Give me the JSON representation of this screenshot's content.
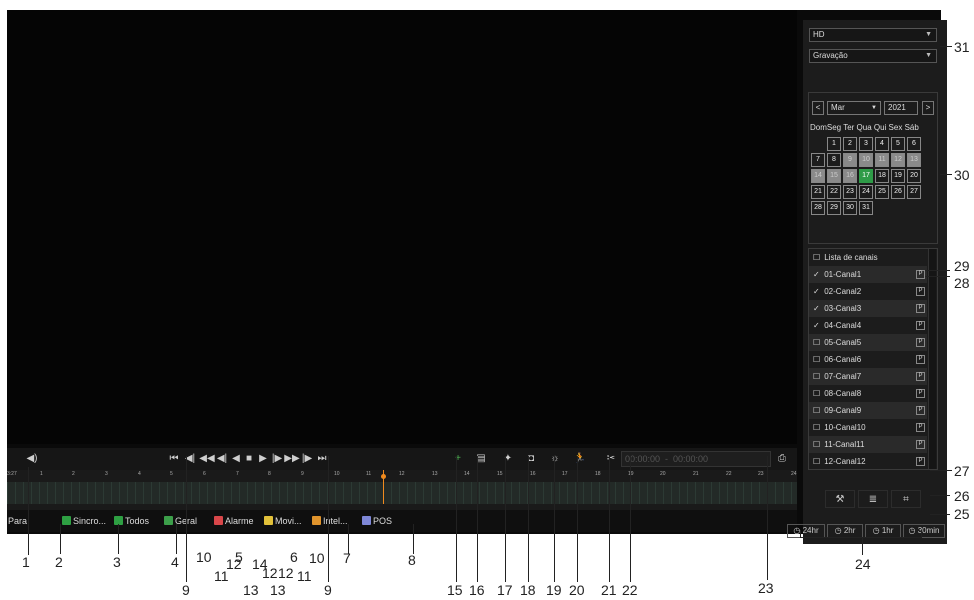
{
  "controls": {
    "status": "Para",
    "time_range": "00:00:00  -  00:00:00",
    "icons": [
      "speaker-icon",
      "skip-start-icon",
      "prev-frame-icon",
      "rewind-icon",
      "slow-backward-icon",
      "play-backward-icon",
      "stop-icon",
      "play-icon",
      "slow-forward-icon",
      "fast-forward-icon",
      "next-frame-icon",
      "skip-end-icon",
      "zoom-icon",
      "snapshot-list-icon",
      "pin-icon",
      "camera-icon",
      "smart-search-icon",
      "person-search-icon",
      "scissors-icon",
      "save-icon"
    ],
    "symbols": {
      "speaker": "◀)",
      "skip_start": "⏮",
      "prev_frame": "◀|",
      "rewind": "◀◀",
      "slow_back": "◀|",
      "play_back": "◀",
      "stop": "■",
      "play": "▶",
      "slow_fwd": "|▶",
      "ffwd": "▶▶",
      "next_frame": "|▶",
      "skip_end": "⏭",
      "zoom": "+",
      "snap": "▤",
      "pin": "✦",
      "camera": "◘",
      "smart": "☼",
      "person": "🏃",
      "cut": "✂",
      "save": "⎙"
    }
  },
  "timeline": {
    "ticks": [
      "3:27",
      "1",
      "2",
      "3",
      "4",
      "5",
      "6",
      "7",
      "8",
      "9",
      "10",
      "11",
      "12",
      "13",
      "14",
      "15",
      "16",
      "17",
      "18",
      "19",
      "20",
      "21",
      "22",
      "23",
      "24"
    ],
    "cursor_hour": 11.5
  },
  "filters": [
    {
      "label": "Sincro...",
      "color": "#2ea043"
    },
    {
      "label": "Todos",
      "color": "#2ea043"
    },
    {
      "label": "Geral",
      "color": "#3c9f4a"
    },
    {
      "label": "Alarme",
      "color": "#d9474a"
    },
    {
      "label": "Movi...",
      "color": "#e2c13a"
    },
    {
      "label": "Intel...",
      "color": "#e0942c"
    },
    {
      "label": "POS",
      "color": "#7f88d8"
    }
  ],
  "side": {
    "quality": "HD",
    "mode": "Gravação",
    "calendar": {
      "prev": "<",
      "next": ">",
      "month": "Mar",
      "year": "2021",
      "dow": "DomSeg Ter Qua Qui Sex Sáb",
      "first_offset": 1,
      "days": 31,
      "recorded": [
        9,
        10,
        11,
        12,
        13,
        14,
        15,
        16
      ],
      "today": 17
    },
    "channel_header": "Lista de canais",
    "channels": [
      {
        "name": "01-Canal1",
        "checked": true
      },
      {
        "name": "02-Canal2",
        "checked": true
      },
      {
        "name": "03-Canal3",
        "checked": true
      },
      {
        "name": "04-Canal4",
        "checked": true
      },
      {
        "name": "05-Canal5",
        "checked": false
      },
      {
        "name": "06-Canal6",
        "checked": false
      },
      {
        "name": "07-Canal7",
        "checked": false
      },
      {
        "name": "08-Canal8",
        "checked": false
      },
      {
        "name": "09-Canal9",
        "checked": false
      },
      {
        "name": "10-Canal10",
        "checked": false
      },
      {
        "name": "11-Canal11",
        "checked": false
      },
      {
        "name": "12-Canal12",
        "checked": false
      }
    ],
    "badge": "P",
    "tools": [
      "⚒",
      "≣",
      "⌗"
    ],
    "spans": [
      "24hr",
      "2hr",
      "1hr",
      "30min"
    ]
  },
  "callouts": {
    "bottom": [
      {
        "n": "1"
      },
      {
        "n": "2"
      },
      {
        "n": "3"
      },
      {
        "n": "4"
      },
      {
        "n": "10"
      },
      {
        "n": "5"
      },
      {
        "n": "14"
      },
      {
        "n": "6"
      },
      {
        "n": "10"
      },
      {
        "n": "7"
      },
      {
        "n": "8"
      }
    ],
    "stagger": [
      {
        "n": "9"
      },
      {
        "n": "11"
      },
      {
        "n": "12"
      },
      {
        "n": "13"
      },
      {
        "n": "12"
      },
      {
        "n": "13"
      },
      {
        "n": "12"
      },
      {
        "n": "11"
      },
      {
        "n": "9"
      },
      {
        "n": "15"
      },
      {
        "n": "16"
      },
      {
        "n": "17"
      },
      {
        "n": "18"
      },
      {
        "n": "19"
      },
      {
        "n": "20"
      },
      {
        "n": "21"
      },
      {
        "n": "22"
      },
      {
        "n": "23"
      }
    ],
    "side": [
      {
        "n": "31"
      },
      {
        "n": "30"
      },
      {
        "n": "29"
      },
      {
        "n": "28"
      },
      {
        "n": "27"
      },
      {
        "n": "26"
      },
      {
        "n": "25"
      },
      {
        "n": "24"
      }
    ]
  }
}
